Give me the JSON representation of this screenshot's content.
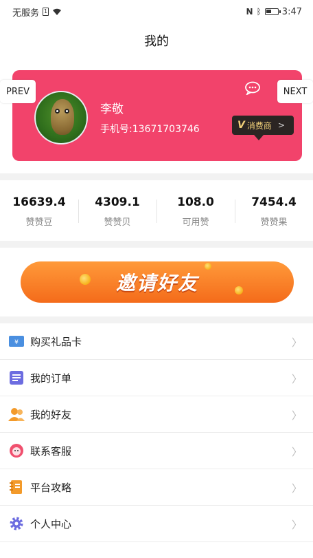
{
  "status_bar": {
    "carrier": "无服务",
    "time": "3:47"
  },
  "header": {
    "title": "我的"
  },
  "nav": {
    "prev_label": "PREV",
    "next_label": "NEXT"
  },
  "profile": {
    "name": "李敬",
    "phone": "手机号:13671703746",
    "badge_mark": "V",
    "badge_label": "消费商",
    "badge_arrow": ">",
    "card_color": "#f2436b"
  },
  "stats": [
    {
      "value": "16639.4",
      "label": "赞赞豆"
    },
    {
      "value": "4309.1",
      "label": "赞赞贝"
    },
    {
      "value": "108.0",
      "label": "可用赞"
    },
    {
      "value": "7454.4",
      "label": "赞赞果"
    }
  ],
  "banner": {
    "text": "邀请好友"
  },
  "menu": [
    {
      "label": "购买礼品卡",
      "icon": "gift-card-icon",
      "color": "#4a8fe0"
    },
    {
      "label": "我的订单",
      "icon": "order-list-icon",
      "color": "#6c6ce0"
    },
    {
      "label": "我的好友",
      "icon": "friends-icon",
      "color": "#f39a2a"
    },
    {
      "label": "联系客服",
      "icon": "customer-service-icon",
      "color": "#f0506e"
    },
    {
      "label": "平台攻略",
      "icon": "guide-book-icon",
      "color": "#f39a2a"
    },
    {
      "label": "个人中心",
      "icon": "settings-gear-icon",
      "color": "#6c6ce0"
    }
  ]
}
